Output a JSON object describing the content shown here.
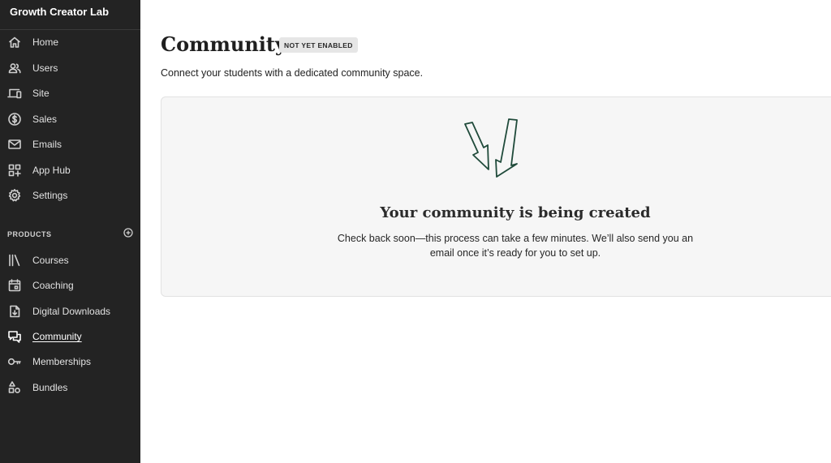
{
  "brand": {
    "name": "Growth Creator Lab"
  },
  "nav": {
    "main": [
      {
        "label": "Home",
        "icon": "home-icon"
      },
      {
        "label": "Users",
        "icon": "users-icon"
      },
      {
        "label": "Site",
        "icon": "devices-icon"
      },
      {
        "label": "Sales",
        "icon": "dollar-circle-icon"
      },
      {
        "label": "Emails",
        "icon": "envelope-icon"
      },
      {
        "label": "App Hub",
        "icon": "apps-grid-icon"
      },
      {
        "label": "Settings",
        "icon": "gear-icon"
      }
    ],
    "products_heading": "PRODUCTS",
    "products": [
      {
        "label": "Courses",
        "icon": "books-icon"
      },
      {
        "label": "Coaching",
        "icon": "calendar-icon"
      },
      {
        "label": "Digital Downloads",
        "icon": "download-file-icon"
      },
      {
        "label": "Community",
        "icon": "chat-bubbles-icon",
        "active": true
      },
      {
        "label": "Memberships",
        "icon": "key-icon"
      },
      {
        "label": "Bundles",
        "icon": "shapes-icon"
      }
    ]
  },
  "page": {
    "title": "Community",
    "badge": "NOT YET ENABLED",
    "subtitle": "Connect your students with a dedicated community space."
  },
  "panel": {
    "icon": "arrows-down-icon",
    "title": "Your community is being created",
    "message": "Check back soon—this process can take a few minutes. We’ll also send you an email once it’s ready for you to set up."
  },
  "colors": {
    "sidebar_bg": "#232323",
    "panel_bg": "#f6f6f6",
    "arrow_stroke": "#1f4a3a"
  }
}
